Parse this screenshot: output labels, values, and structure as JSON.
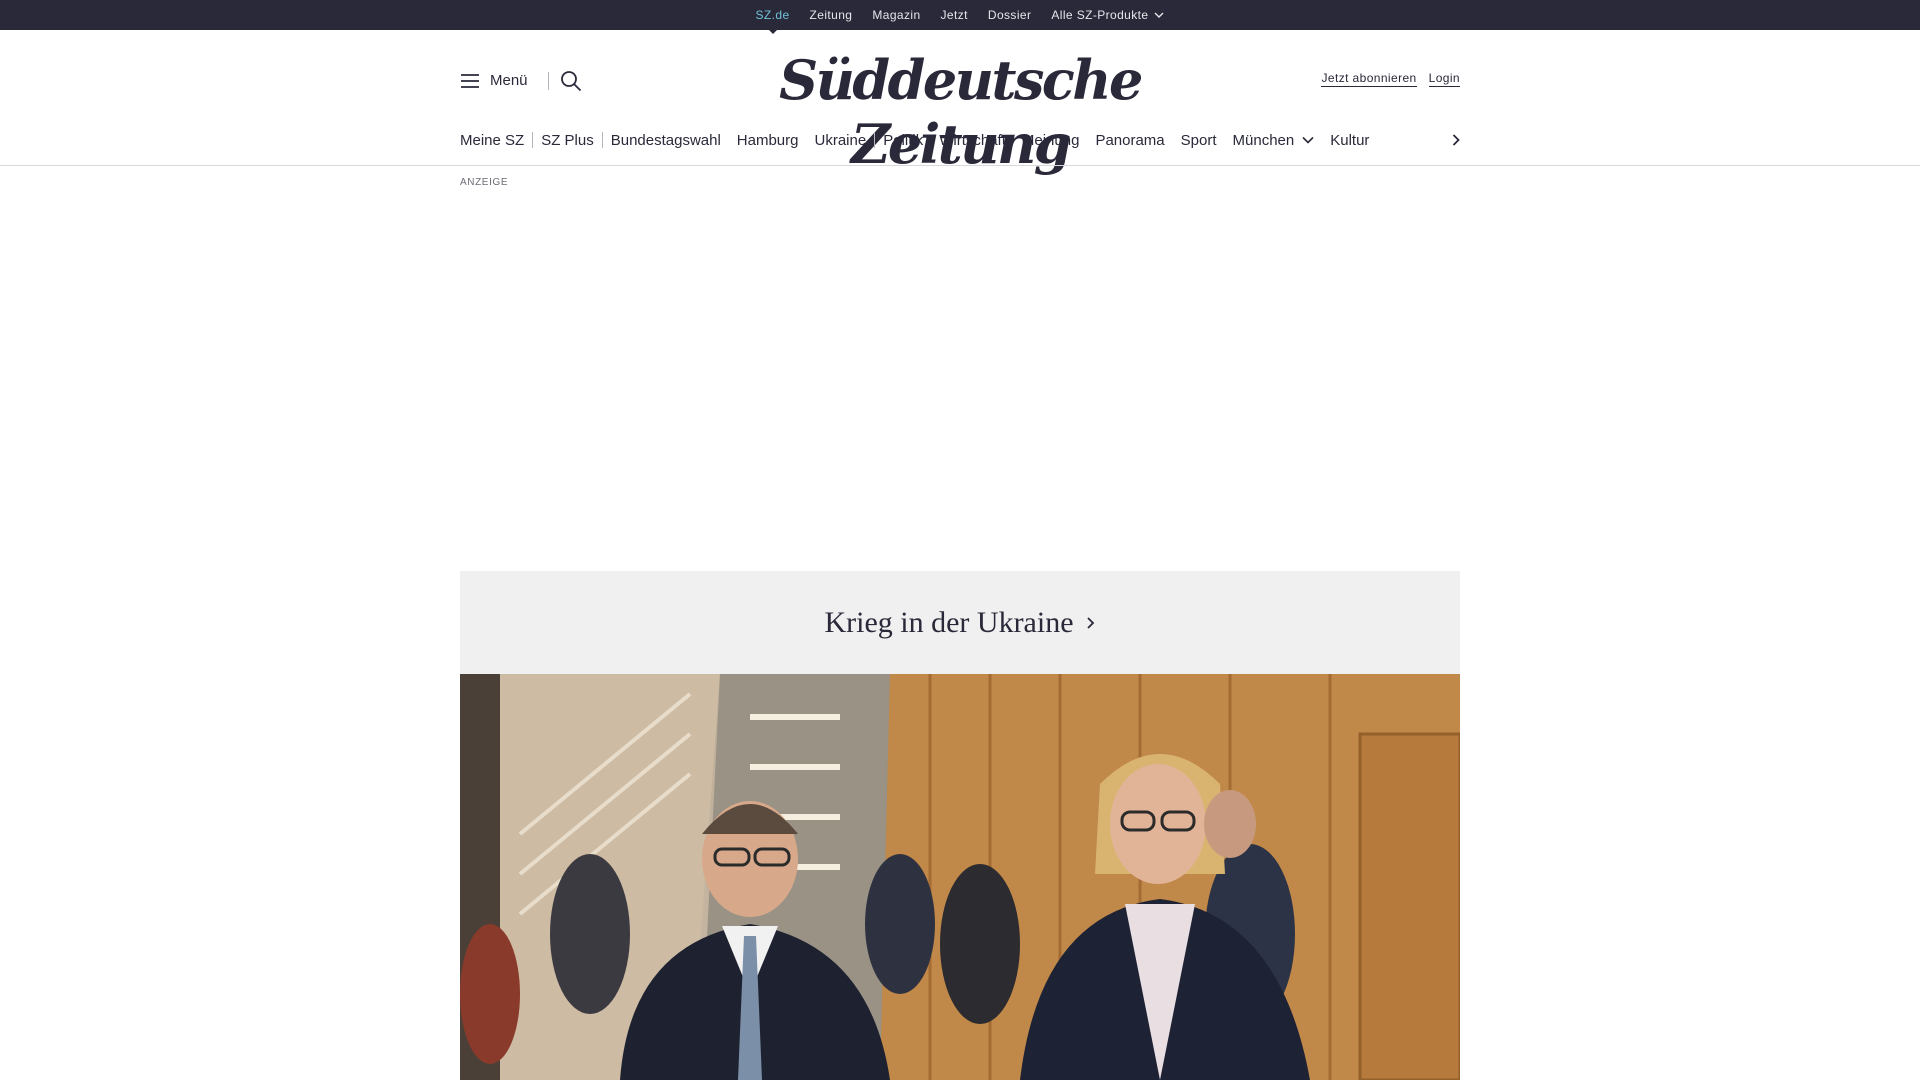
{
  "topbar": {
    "items": [
      "SZ.de",
      "Zeitung",
      "Magazin",
      "Jetzt",
      "Dossier",
      "Alle SZ-Produkte"
    ],
    "active_index": 0,
    "active_color": "#71c3d6",
    "background": "#29293a"
  },
  "header": {
    "menu_label": "Menü",
    "logo_text": "Süddeutsche Zeitung",
    "subscribe_label": "Jetzt abonnieren",
    "login_label": "Login"
  },
  "section_nav": {
    "items": [
      "Meine SZ",
      "SZ Plus",
      "Bundestagswahl",
      "Hamburg",
      "Ukraine",
      "Politik",
      "Wirtschaft",
      "Meinung",
      "Panorama",
      "Sport",
      "München",
      "Kultur"
    ]
  },
  "ad": {
    "label": "ANZEIGE"
  },
  "topic_banner": {
    "title": "Krieg in der Ukraine"
  },
  "hero_image": {
    "icon": "news-photo"
  }
}
